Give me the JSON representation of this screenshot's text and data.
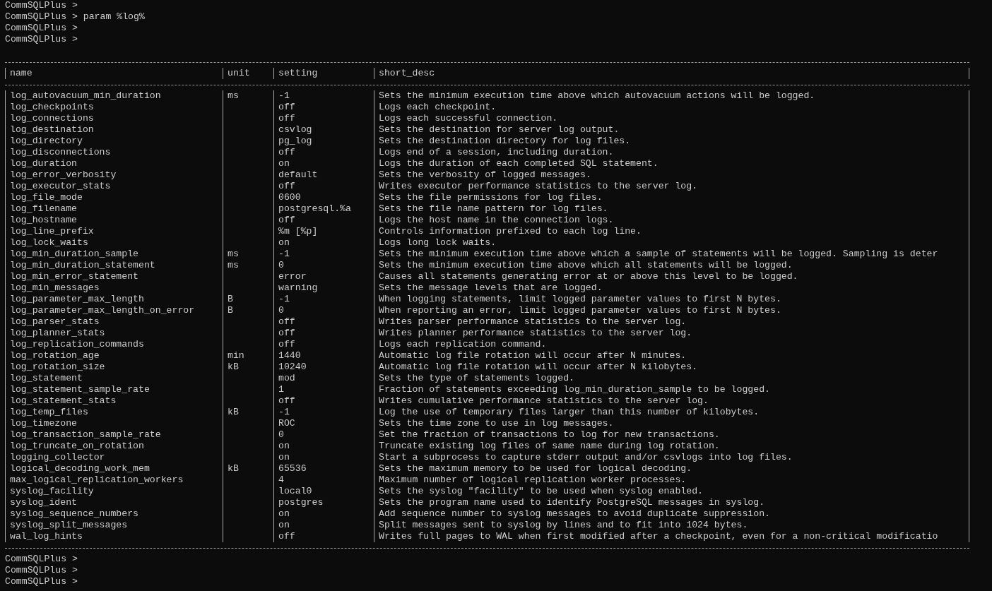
{
  "prompt_lines_top": [
    "CommSQLPlus >",
    "CommSQLPlus > param %log%",
    "CommSQLPlus >",
    "CommSQLPlus >"
  ],
  "table": {
    "columns": [
      "name",
      "unit",
      "setting",
      "short_desc"
    ],
    "rows": [
      {
        "name": "log_autovacuum_min_duration",
        "unit": "ms",
        "setting": "-1",
        "short_desc": "Sets the minimum execution time above which autovacuum actions will be logged."
      },
      {
        "name": "log_checkpoints",
        "setting": "off",
        "short_desc": "Logs each checkpoint."
      },
      {
        "name": "log_connections",
        "setting": "off",
        "short_desc": "Logs each successful connection."
      },
      {
        "name": "log_destination",
        "setting": "csvlog",
        "short_desc": "Sets the destination for server log output."
      },
      {
        "name": "log_directory",
        "setting": "pg_log",
        "short_desc": "Sets the destination directory for log files."
      },
      {
        "name": "log_disconnections",
        "setting": "off",
        "short_desc": "Logs end of a session, including duration."
      },
      {
        "name": "log_duration",
        "setting": "on",
        "short_desc": "Logs the duration of each completed SQL statement."
      },
      {
        "name": "log_error_verbosity",
        "setting": "default",
        "short_desc": "Sets the verbosity of logged messages."
      },
      {
        "name": "log_executor_stats",
        "setting": "off",
        "short_desc": "Writes executor performance statistics to the server log."
      },
      {
        "name": "log_file_mode",
        "setting": "0600",
        "short_desc": "Sets the file permissions for log files."
      },
      {
        "name": "log_filename",
        "setting": "postgresql.%a",
        "short_desc": "Sets the file name pattern for log files."
      },
      {
        "name": "log_hostname",
        "setting": "off",
        "short_desc": "Logs the host name in the connection logs."
      },
      {
        "name": "log_line_prefix",
        "setting": "%m [%p]",
        "short_desc": "Controls information prefixed to each log line."
      },
      {
        "name": "log_lock_waits",
        "setting": "on",
        "short_desc": "Logs long lock waits."
      },
      {
        "name": "log_min_duration_sample",
        "unit": "ms",
        "setting": "-1",
        "short_desc": "Sets the minimum execution time above which a sample of statements will be logged. Sampling is deter"
      },
      {
        "name": "log_min_duration_statement",
        "unit": "ms",
        "setting": "0",
        "short_desc": "Sets the minimum execution time above which all statements will be logged."
      },
      {
        "name": "log_min_error_statement",
        "setting": "error",
        "short_desc": "Causes all statements generating error at or above this level to be logged."
      },
      {
        "name": "log_min_messages",
        "setting": "warning",
        "short_desc": "Sets the message levels that are logged."
      },
      {
        "name": "log_parameter_max_length",
        "unit": "B",
        "setting": "-1",
        "short_desc": "When logging statements, limit logged parameter values to first N bytes."
      },
      {
        "name": "log_parameter_max_length_on_error",
        "unit": "B",
        "setting": "0",
        "short_desc": "When reporting an error, limit logged parameter values to first N bytes."
      },
      {
        "name": "log_parser_stats",
        "setting": "off",
        "short_desc": "Writes parser performance statistics to the server log."
      },
      {
        "name": "log_planner_stats",
        "setting": "off",
        "short_desc": "Writes planner performance statistics to the server log."
      },
      {
        "name": "log_replication_commands",
        "setting": "off",
        "short_desc": "Logs each replication command."
      },
      {
        "name": "log_rotation_age",
        "unit": "min",
        "setting": "1440",
        "short_desc": "Automatic log file rotation will occur after N minutes."
      },
      {
        "name": "log_rotation_size",
        "unit": "kB",
        "setting": "10240",
        "short_desc": "Automatic log file rotation will occur after N kilobytes."
      },
      {
        "name": "log_statement",
        "setting": "mod",
        "short_desc": "Sets the type of statements logged."
      },
      {
        "name": "log_statement_sample_rate",
        "setting": "1",
        "short_desc": "Fraction of statements exceeding log_min_duration_sample to be logged."
      },
      {
        "name": "log_statement_stats",
        "setting": "off",
        "short_desc": "Writes cumulative performance statistics to the server log."
      },
      {
        "name": "log_temp_files",
        "unit": "kB",
        "setting": "-1",
        "short_desc": "Log the use of temporary files larger than this number of kilobytes."
      },
      {
        "name": "log_timezone",
        "setting": "ROC",
        "short_desc": "Sets the time zone to use in log messages."
      },
      {
        "name": "log_transaction_sample_rate",
        "setting": "0",
        "short_desc": "Set the fraction of transactions to log for new transactions."
      },
      {
        "name": "log_truncate_on_rotation",
        "setting": "on",
        "short_desc": "Truncate existing log files of same name during log rotation."
      },
      {
        "name": "logging_collector",
        "setting": "on",
        "short_desc": "Start a subprocess to capture stderr output and/or csvlogs into log files."
      },
      {
        "name": "logical_decoding_work_mem",
        "unit": "kB",
        "setting": "65536",
        "short_desc": "Sets the maximum memory to be used for logical decoding."
      },
      {
        "name": "max_logical_replication_workers",
        "setting": "4",
        "short_desc": "Maximum number of logical replication worker processes."
      },
      {
        "name": "syslog_facility",
        "setting": "local0",
        "short_desc": "Sets the syslog \"facility\" to be used when syslog enabled."
      },
      {
        "name": "syslog_ident",
        "setting": "postgres",
        "short_desc": "Sets the program name used to identify PostgreSQL messages in syslog."
      },
      {
        "name": "syslog_sequence_numbers",
        "setting": "on",
        "short_desc": "Add sequence number to syslog messages to avoid duplicate suppression."
      },
      {
        "name": "syslog_split_messages",
        "setting": "on",
        "short_desc": "Split messages sent to syslog by lines and to fit into 1024 bytes."
      },
      {
        "name": "wal_log_hints",
        "setting": "off",
        "short_desc": "Writes full pages to WAL when first modified after a checkpoint, even for a non-critical modificatio"
      }
    ]
  },
  "prompt_lines_bottom": [
    "CommSQLPlus >",
    "CommSQLPlus >",
    "CommSQLPlus >"
  ]
}
